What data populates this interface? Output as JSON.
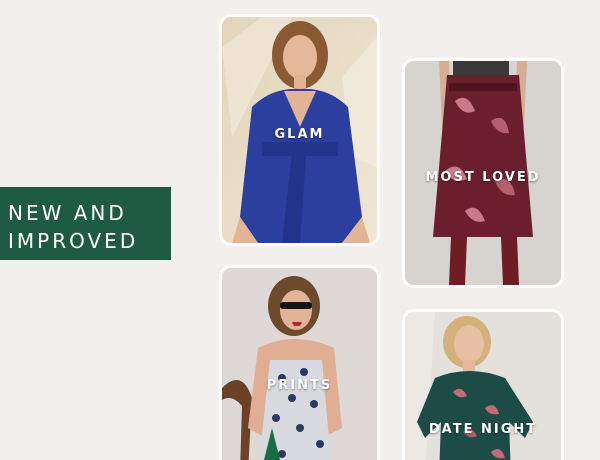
{
  "promo": {
    "line1": "NEW AND",
    "line2": "IMPROVED",
    "background_color": "#1f5a43"
  },
  "categories": [
    {
      "label": "GLAM",
      "dress_color": "#2b3f9e"
    },
    {
      "label": "MOST LOVED",
      "dress_color": "#6b1f2c"
    },
    {
      "label": "PRINTS",
      "dress_color": "#d9d9e0"
    },
    {
      "label": "DATE NIGHT",
      "dress_color": "#1d4b45"
    }
  ]
}
